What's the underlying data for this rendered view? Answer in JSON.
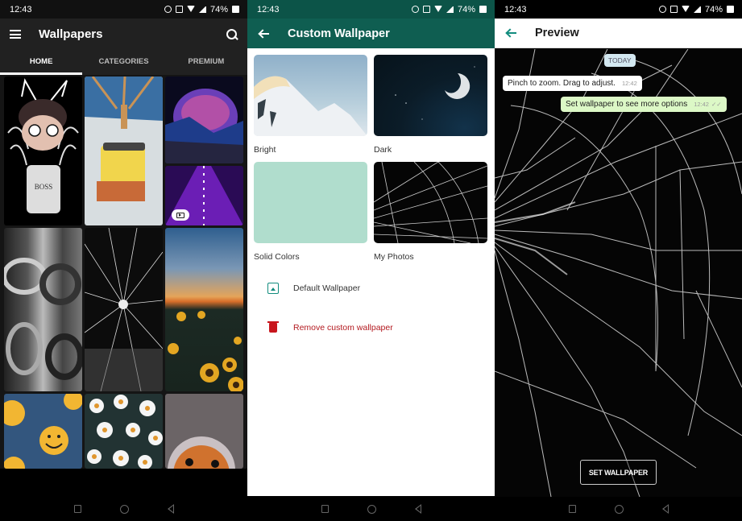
{
  "status_bar": {
    "time": "12:43",
    "battery": "74%",
    "icons": [
      "alarm-icon",
      "vibrate-icon",
      "wifi-icon",
      "signal-icon",
      "battery-icon"
    ]
  },
  "wallpapers_app": {
    "title": "Wallpapers",
    "menu_icon": "hamburger-menu-icon",
    "search_icon": "search-icon",
    "tabs": [
      {
        "label": "HOME",
        "active": true
      },
      {
        "label": "CATEGORIES",
        "active": false
      },
      {
        "label": "PREMIUM",
        "active": false
      }
    ],
    "thumbnails": [
      {
        "subject": "cartoon boy with angel wings BOSS hoodie"
      },
      {
        "subject": "spongebob in beach chair with sunglasses"
      },
      {
        "subject": "neon planet over mountains"
      },
      {
        "subject": "purple neon road",
        "badge": "video-play-icon"
      },
      {
        "subject": "black and white dragons"
      },
      {
        "subject": "cracked glass"
      },
      {
        "subject": "sunflower field at sunset"
      },
      {
        "subject": "smiley faces on blue"
      },
      {
        "subject": "daisy flowers"
      },
      {
        "subject": "cat in hood"
      }
    ]
  },
  "custom_wallpaper": {
    "title": "Custom Wallpaper",
    "back_icon": "back-arrow-icon",
    "options": [
      {
        "label": "Bright"
      },
      {
        "label": "Dark"
      },
      {
        "label": "Solid Colors"
      },
      {
        "label": "My Photos"
      }
    ],
    "actions": [
      {
        "label": "Default Wallpaper",
        "icon": "default-wallpaper-icon"
      },
      {
        "label": "Remove custom wallpaper",
        "icon": "trash-icon"
      }
    ],
    "colors": {
      "appbar": "#0f5e51",
      "accent": "#128c7e",
      "danger": "#b3191f"
    }
  },
  "preview": {
    "title": "Preview",
    "back_icon": "back-arrow-icon",
    "date_chip": "TODAY",
    "messages": [
      {
        "text": "Pinch to zoom. Drag to adjust.",
        "time": "12:42",
        "direction": "incoming"
      },
      {
        "text": "Set wallpaper to see more options",
        "time": "12:42",
        "direction": "outgoing",
        "ticks": "✓✓"
      }
    ],
    "set_button": "SET WALLPAPER"
  },
  "nav_bar": {
    "buttons": [
      "recents-button",
      "home-button",
      "back-button"
    ]
  }
}
